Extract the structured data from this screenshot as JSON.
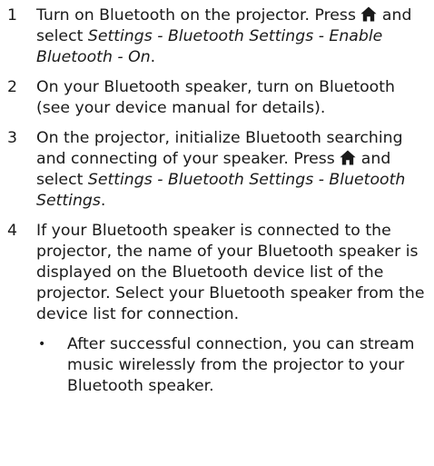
{
  "steps": [
    {
      "number": "1",
      "before_icon": "Turn on Bluetooth on the projector. Press ",
      "icon": "home-icon",
      "after_icon": " and select ",
      "path": "Settings - Bluetooth Settings - Enable Bluetooth - On",
      "end": "."
    },
    {
      "number": "2",
      "text": "On your Bluetooth speaker, turn on Bluetooth (see your device manual for details)."
    },
    {
      "number": "3",
      "intro": "On the projector, initialize Bluetooth searching and connecting of your speaker. Press ",
      "icon": "home-icon",
      "after_icon": " and select ",
      "path": "Settings - Bluetooth Settings - Bluetooth Settings",
      "end": "."
    },
    {
      "number": "4",
      "text": "If your Bluetooth speaker is connected to the projector, the name of your Bluetooth speaker is displayed on the Bluetooth device list of the projector. Select your Bluetooth speaker from the device list for connection.",
      "subitems": [
        {
          "bullet": "•",
          "text": "After successful connection, you can stream music wirelessly from the projector to your Bluetooth speaker."
        }
      ]
    }
  ]
}
